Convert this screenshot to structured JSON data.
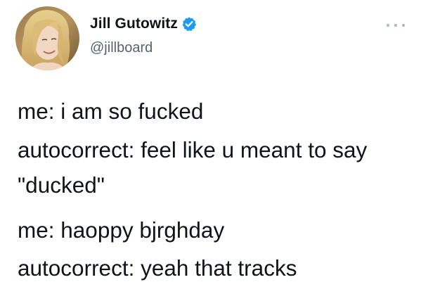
{
  "tweet": {
    "author": {
      "display_name": "Jill Gutowitz",
      "handle": "@jillboard",
      "verified_icon": "verified-badge-icon",
      "avatar_icon": "profile-photo"
    },
    "more_icon": "more-options-icon",
    "lines": [
      "me: i am so fucked",
      "autocorrect: feel like u meant to say",
      "\"ducked\"",
      "me: haoppy bjrghday",
      "autocorrect: yeah that tracks"
    ]
  },
  "colors": {
    "text": "#0f1419",
    "handle": "#536471",
    "verified": "#1d9bf0",
    "more_dots": "#aab8c2",
    "background": "#ffffff"
  }
}
